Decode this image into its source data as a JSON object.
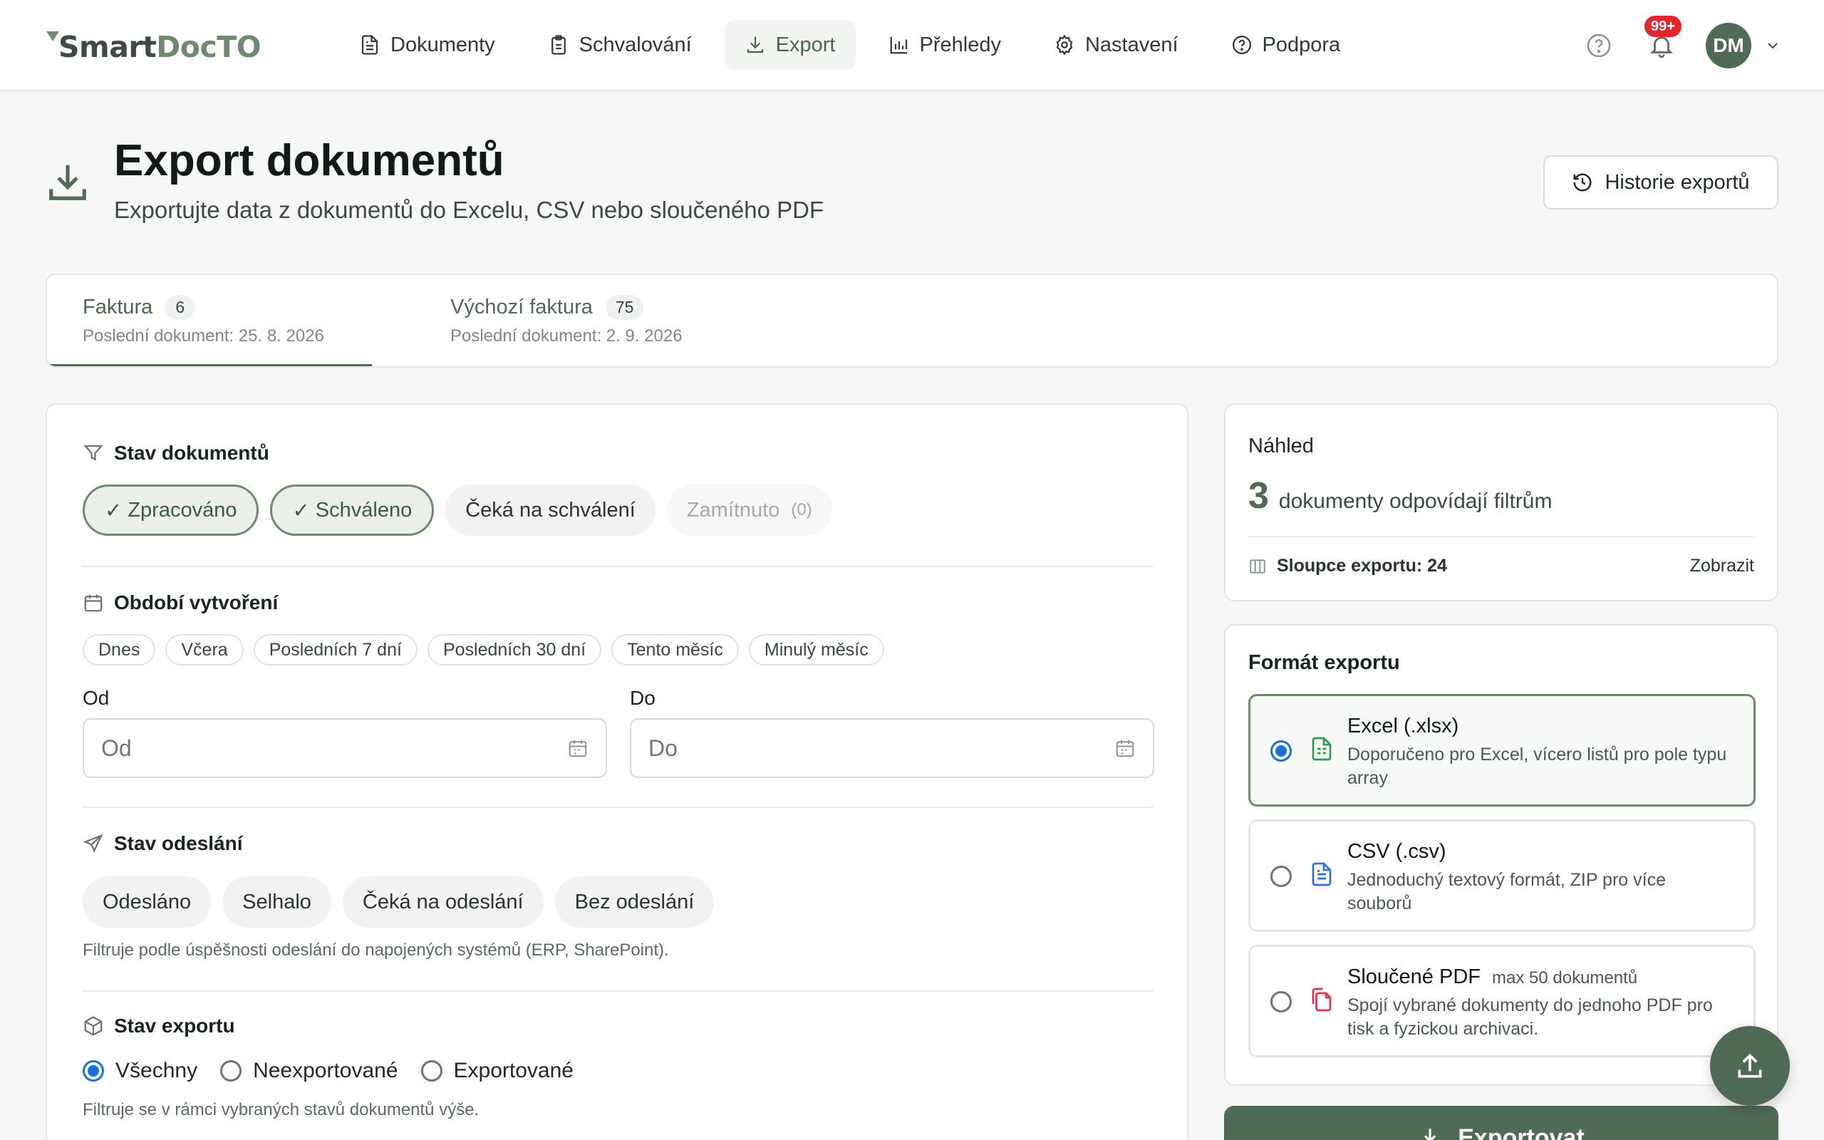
{
  "brand": {
    "logo_a": "Smart",
    "logo_b": "DocTO"
  },
  "nav": [
    {
      "label": "Dokumenty",
      "icon": "document-icon"
    },
    {
      "label": "Schvalování",
      "icon": "clipboard-check-icon"
    },
    {
      "label": "Export",
      "icon": "download-icon",
      "active": true
    },
    {
      "label": "Přehledy",
      "icon": "bar-chart-icon"
    },
    {
      "label": "Nastavení",
      "icon": "gear-icon"
    },
    {
      "label": "Podpora",
      "icon": "help-circle-icon"
    }
  ],
  "topbar": {
    "notifications_badge": "99+",
    "user_initials": "DM"
  },
  "header": {
    "title": "Export dokumentů",
    "subtitle": "Exportujte data z dokumentů do Excelu, CSV nebo sloučeného PDF",
    "history_button": "Historie exportů"
  },
  "tabs": [
    {
      "name": "Faktura",
      "count": "6",
      "last": "Poslední dokument: 25. 8. 2026"
    },
    {
      "name": "Výchozí faktura",
      "count": "75",
      "last": "Poslední dokument: 2. 9. 2026"
    }
  ],
  "filters": {
    "status": {
      "title": "Stav dokumentů",
      "chips": [
        {
          "label": "Zpracováno",
          "selected": true
        },
        {
          "label": "Schváleno",
          "selected": true
        },
        {
          "label": "Čeká na schválení",
          "selected": false
        },
        {
          "label": "Zamítnuto",
          "count": "(0)",
          "disabled": true
        }
      ]
    },
    "period": {
      "title": "Období vytvoření",
      "presets": [
        "Dnes",
        "Včera",
        "Posledních 7 dní",
        "Posledních 30 dní",
        "Tento měsíc",
        "Minulý měsíc"
      ],
      "from_label": "Od",
      "to_label": "Do",
      "from_placeholder": "Od",
      "to_placeholder": "Do"
    },
    "sending": {
      "title": "Stav odeslání",
      "chips": [
        "Odesláno",
        "Selhalo",
        "Čeká na odeslání",
        "Bez odeslání"
      ],
      "hint": "Filtruje podle úspěšnosti odeslání do napojených systémů (ERP, SharePoint)."
    },
    "export_state": {
      "title": "Stav exportu",
      "options": [
        "Všechny",
        "Neexportované",
        "Exportované"
      ],
      "selected": "Všechny",
      "hint": "Filtruje se v rámci vybraných stavů dokumentů výše."
    }
  },
  "preview": {
    "title": "Náhled",
    "count": "3",
    "count_text": "dokumenty odpovídají filtrům",
    "columns": "Sloupce exportu: 24",
    "show": "Zobrazit"
  },
  "format": {
    "title": "Formát exportu",
    "options": [
      {
        "name": "Excel (.xlsx)",
        "desc": "Doporučeno pro Excel, vícero listů pro pole typu array",
        "selected": true,
        "icon_color": "#2f9a55"
      },
      {
        "name": "CSV (.csv)",
        "desc": "Jednoduchý textový formát, ZIP pro více souborů",
        "selected": false,
        "icon_color": "#2f6fd8"
      },
      {
        "name": "Sloučené PDF",
        "max": "max 50 dokumentů",
        "desc": "Spojí vybrané dokumenty do jednoho PDF pro tisk a fyzickou archivaci.",
        "selected": false,
        "icon_color": "#e0334f"
      }
    ]
  },
  "export_button": "Exportovat",
  "colors": {
    "accent": "#4f6a55",
    "accent_light": "#eaf0e9",
    "badge": "#e2262b"
  }
}
